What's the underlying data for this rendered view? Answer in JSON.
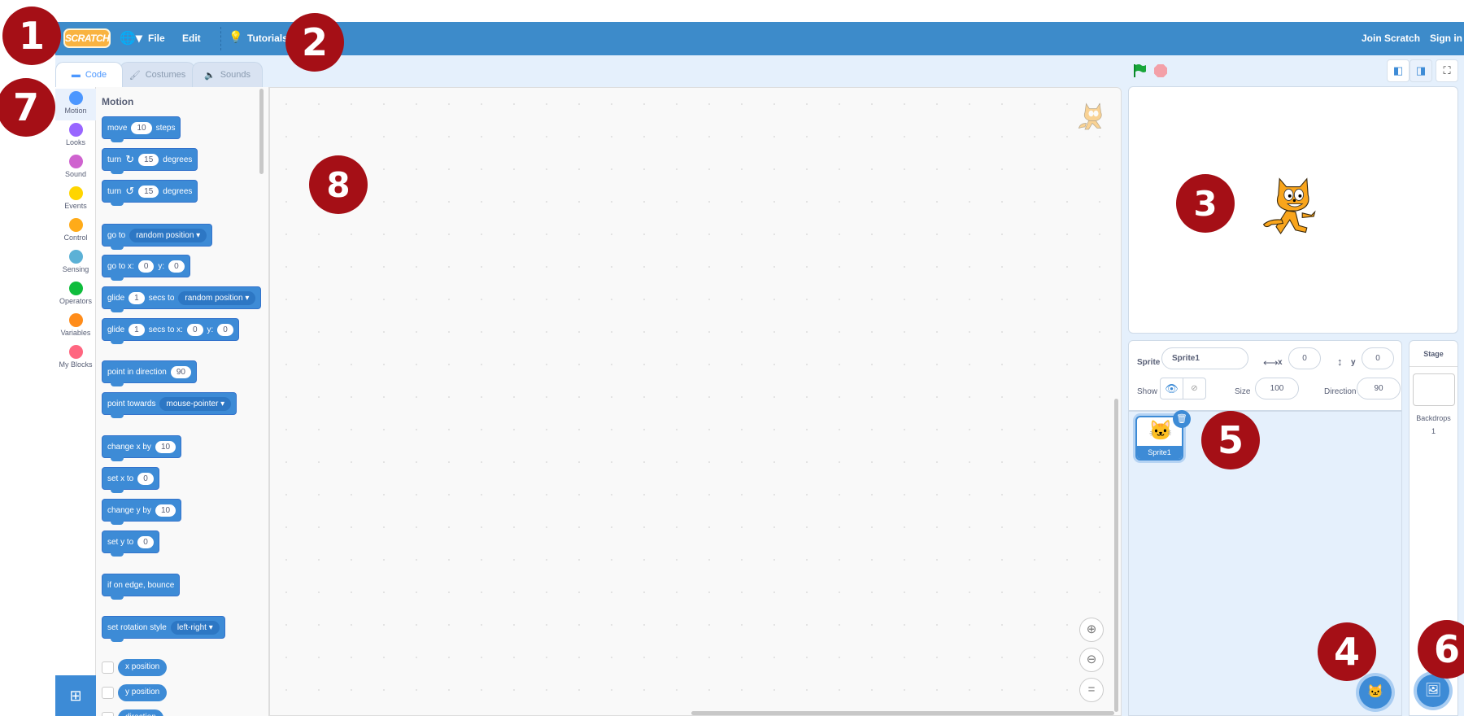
{
  "menubar": {
    "logo": "SCRATCH",
    "file": "File",
    "edit": "Edit",
    "tutorials": "Tutorials",
    "join": "Join Scratch",
    "sign_in": "Sign in"
  },
  "tabs": [
    {
      "label": "Code",
      "active": true
    },
    {
      "label": "Costumes"
    },
    {
      "label": "Sounds"
    }
  ],
  "categories": [
    {
      "label": "Motion",
      "color": "#4c97ff"
    },
    {
      "label": "Looks",
      "color": "#9966ff"
    },
    {
      "label": "Sound",
      "color": "#cf63cf"
    },
    {
      "label": "Events",
      "color": "#ffd500"
    },
    {
      "label": "Control",
      "color": "#ffab19"
    },
    {
      "label": "Sensing",
      "color": "#5cb1d6"
    },
    {
      "label": "Operators",
      "color": "#0fbd3c"
    },
    {
      "label": "Variables",
      "color": "#ff8c1a"
    },
    {
      "label": "My Blocks",
      "color": "#ff6680"
    }
  ],
  "palette": {
    "heading": "Motion",
    "blocks": [
      [
        "move",
        "(10)",
        "steps"
      ],
      [
        "turn",
        "↻",
        "(15)",
        "degrees"
      ],
      [
        "turn",
        "↺",
        "(15)",
        "degrees"
      ],
      [
        "go to",
        "[random position]"
      ],
      [
        "go to x:",
        "(0)",
        "y:",
        "(0)"
      ],
      [
        "glide",
        "(1)",
        "secs to",
        "[random position]"
      ],
      [
        "glide",
        "(1)",
        "secs to x:",
        "(0)",
        "y:",
        "(0)"
      ],
      [
        "point in direction",
        "(90)"
      ],
      [
        "point towards",
        "[mouse-pointer]"
      ],
      [
        "change x by",
        "(10)"
      ],
      [
        "set x to",
        "(0)"
      ],
      [
        "change y by",
        "(10)"
      ],
      [
        "set y to",
        "(0)"
      ],
      [
        "if on edge, bounce"
      ],
      [
        "set rotation style",
        "[left-right]"
      ]
    ],
    "reporters": [
      "x position",
      "y position",
      "direction"
    ]
  },
  "sprite": {
    "label_sprite": "Sprite",
    "name": "Sprite1",
    "x_label": "x",
    "x": "0",
    "y_label": "y",
    "y": "0",
    "show_label": "Show",
    "size_label": "Size",
    "size": "100",
    "direction_label": "Direction",
    "direction": "90",
    "thumb_name": "Sprite1"
  },
  "stage_panel": {
    "title": "Stage",
    "backdrops_label": "Backdrops",
    "backdrops_count": "1"
  },
  "badges": [
    "1",
    "2",
    "3",
    "4",
    "5",
    "6",
    "7",
    "8"
  ]
}
